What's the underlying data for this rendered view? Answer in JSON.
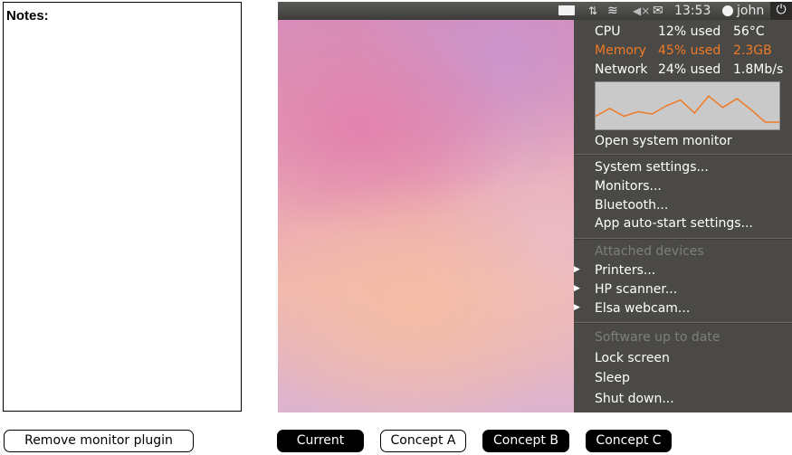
{
  "notes": {
    "title": "Notes:"
  },
  "topbar": {
    "icons": [
      "battery-icon",
      "network-icon",
      "wifi-icon",
      "volume-muted-icon",
      "mail-icon",
      "user-icon",
      "power-icon"
    ],
    "time": "13:53",
    "user": "john",
    "power_glyph": "⏻",
    "network_glyph": "⇅",
    "wifi_glyph": "≋",
    "volume_glyph": "◀×",
    "mail_glyph": "✉"
  },
  "menu": {
    "stats": [
      {
        "name": "CPU",
        "value": "12% used",
        "extra": "56°C"
      },
      {
        "name": "Memory",
        "value": "45% used",
        "extra": "2.3GB",
        "highlight": "#ef7a26"
      },
      {
        "name": "Network",
        "value": "24% used",
        "extra": "1.8Mb/s"
      }
    ],
    "graph": {
      "line_color": "#ef7a26",
      "values": [
        0.18,
        0.42,
        0.18,
        0.32,
        0.25,
        0.5,
        0.68,
        0.28,
        0.8,
        0.45,
        0.72,
        0.38,
        0.0,
        0.0
      ],
      "y_min": 0,
      "y_max": 1
    },
    "open_monitor": "Open system monitor",
    "settings": [
      "System settings...",
      "Monitors...",
      "Bluetooth...",
      "App auto-start settings..."
    ],
    "devices_header": "Attached devices",
    "devices": [
      "Printers...",
      "HP scanner...",
      "Elsa webcam..."
    ],
    "software_status": "Software up to date",
    "session": [
      "Lock screen",
      "Sleep",
      "Shut down..."
    ],
    "submenu_glyph": "▶"
  },
  "buttons": {
    "remove_plugin": "Remove monitor plugin",
    "current": "Current",
    "concept_a": "Concept A",
    "concept_b": "Concept B",
    "concept_c": "Concept C"
  },
  "colors": {
    "menu_bg": "#4a4946",
    "accent": "#ef7a26",
    "dim_text": "#7f7e7b"
  }
}
